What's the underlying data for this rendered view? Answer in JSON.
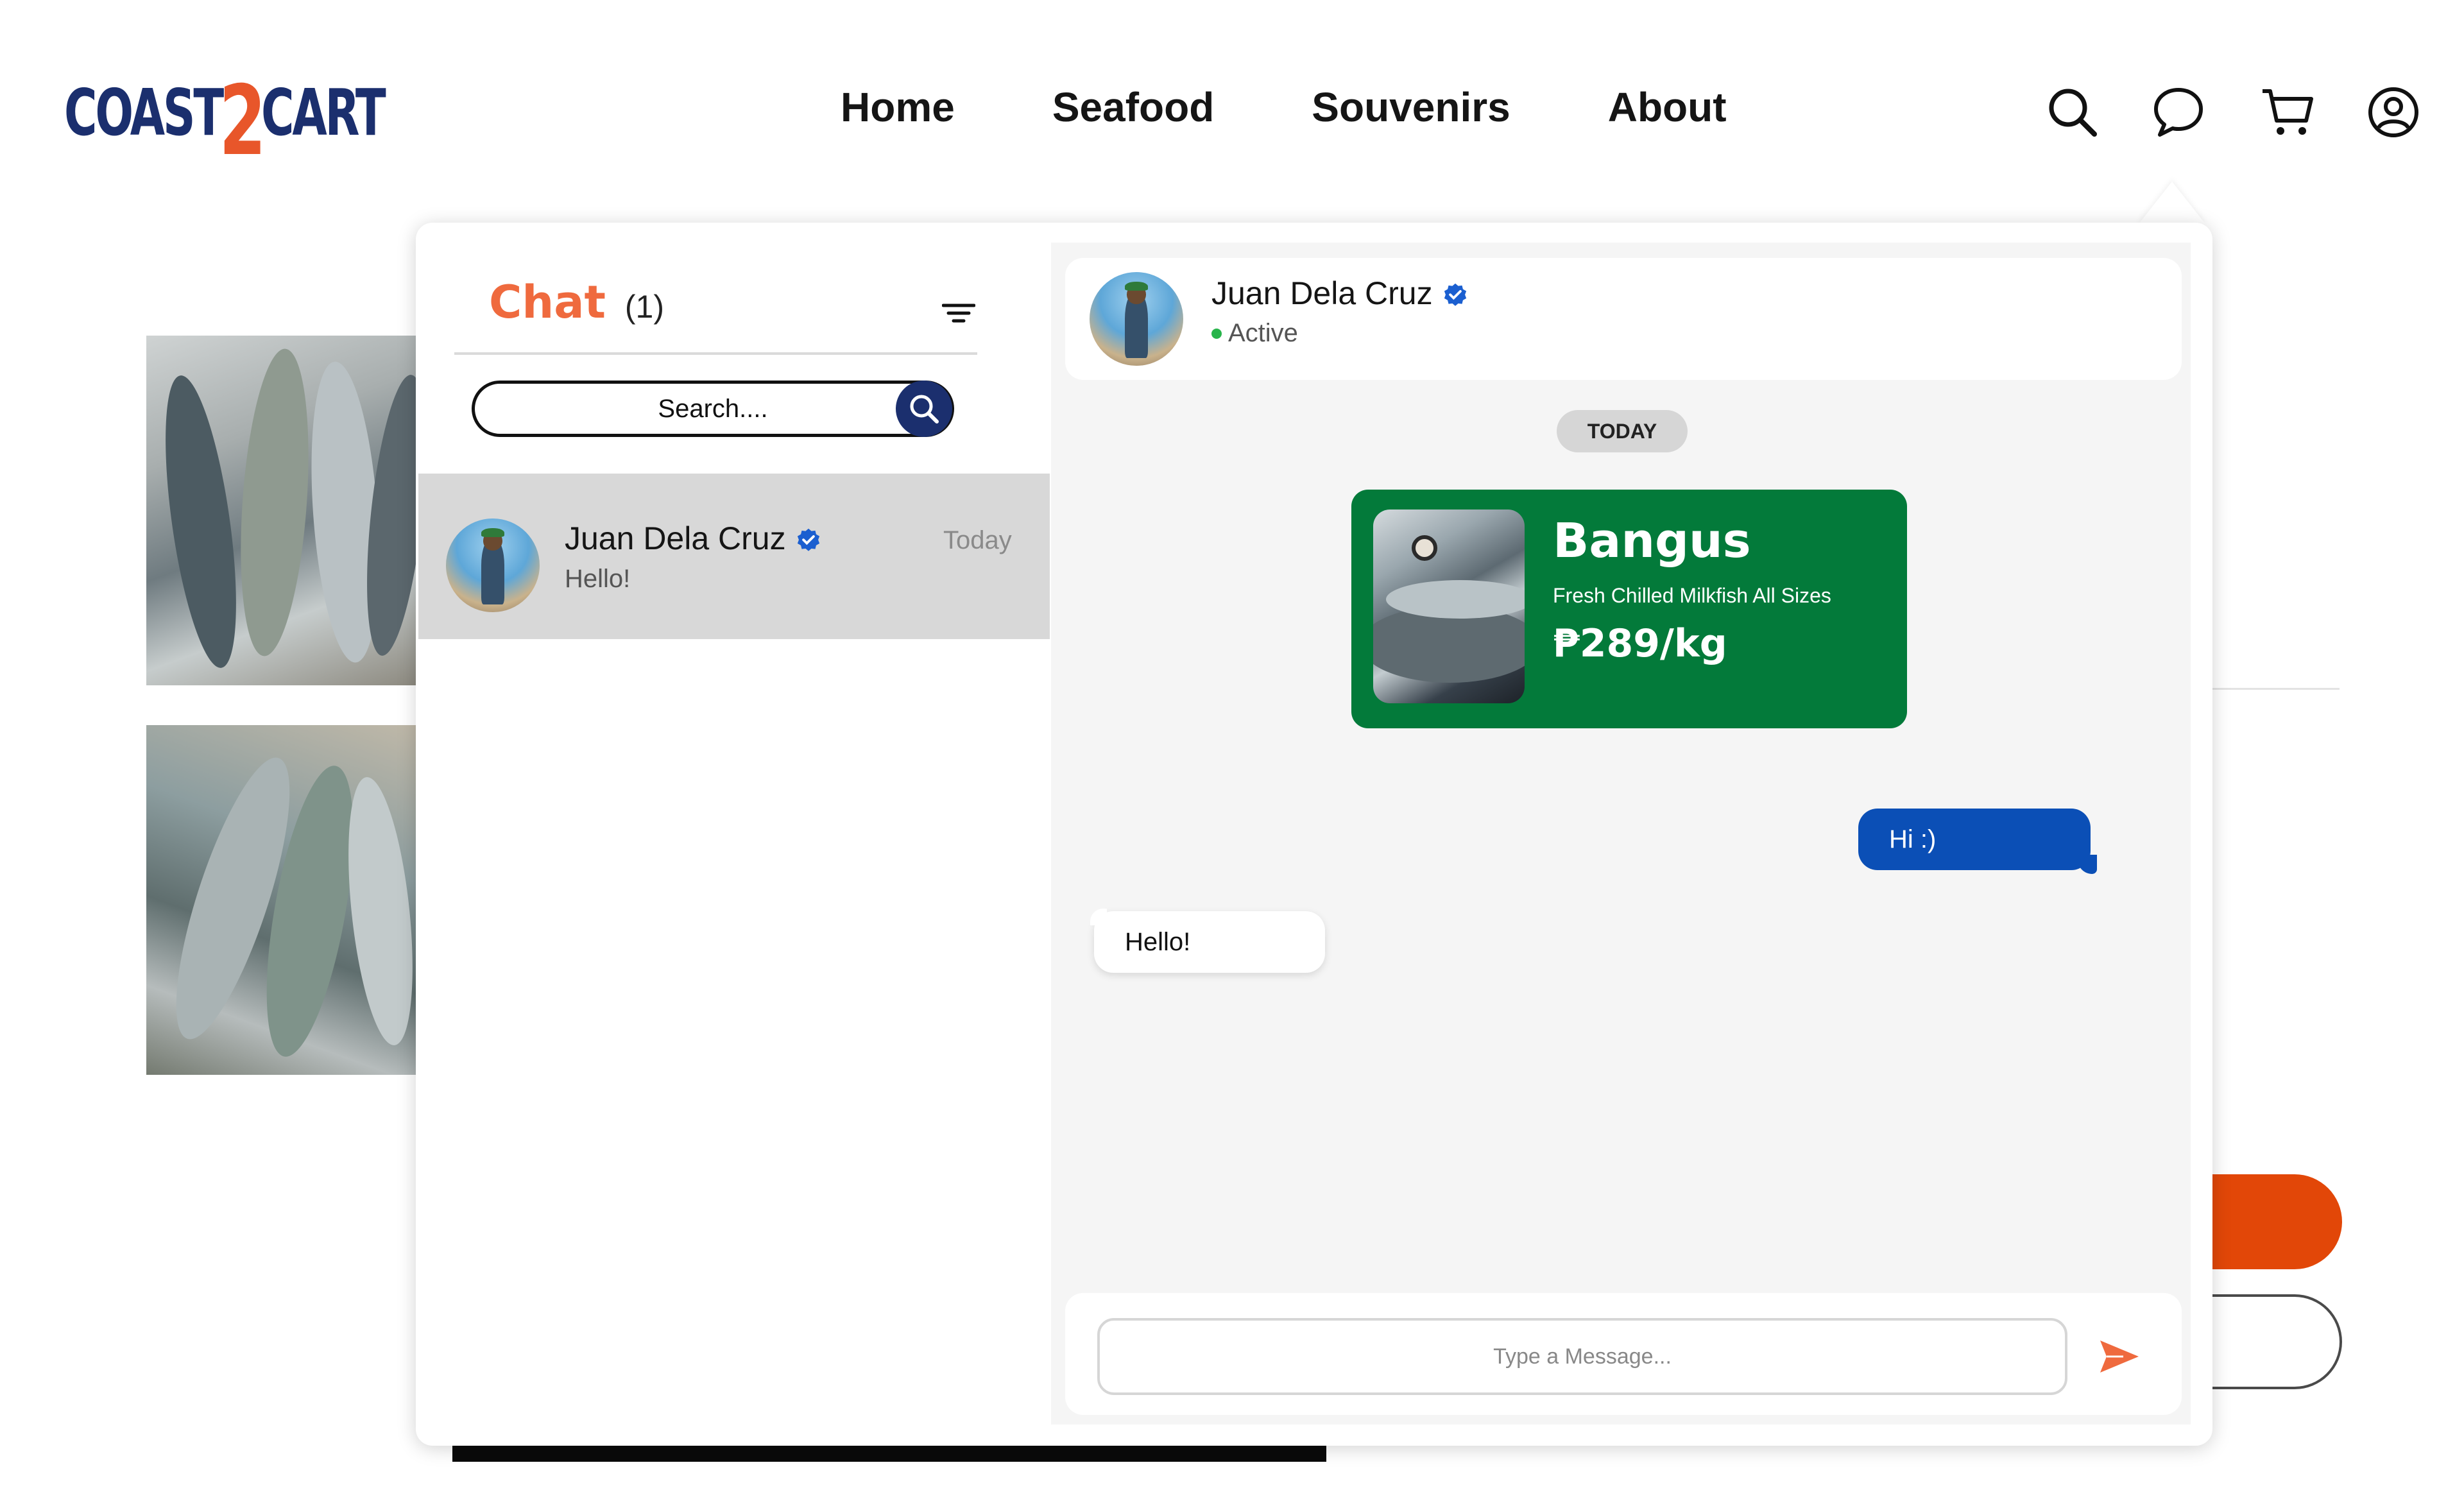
{
  "brand": {
    "logo_left": "COAST",
    "logo_mid": "2",
    "logo_right": "CART"
  },
  "nav": {
    "home": "Home",
    "seafood": "Seafood",
    "souvenirs": "Souvenirs",
    "about": "About"
  },
  "colors": {
    "brand_blue": "#1b2f6e",
    "accent_orange": "#ef6a3e",
    "product_green": "#037a3a",
    "bubble_blue": "#0b4fb6",
    "active_green": "#28b44b",
    "cta_orange": "#e24708"
  },
  "header_icons": [
    "search-icon",
    "chat-icon",
    "cart-icon",
    "account-icon"
  ],
  "chat": {
    "title": "Chat",
    "count": "(1)",
    "search_placeholder": "Search....",
    "conversations": [
      {
        "name": "Juan Dela Cruz",
        "time": "Today",
        "preview": "Hello!",
        "verified": true
      }
    ],
    "active": {
      "name": "Juan Dela Cruz",
      "status": "Active",
      "date_divider": "TODAY",
      "product": {
        "name": "Bangus",
        "description": "Fresh Chilled Milkfish All Sizes",
        "price": "₱289/kg"
      },
      "messages": [
        {
          "direction": "outgoing",
          "text": "Hi :)"
        },
        {
          "direction": "incoming",
          "text": "Hello!"
        }
      ]
    },
    "composer_placeholder": "Type a Message..."
  }
}
